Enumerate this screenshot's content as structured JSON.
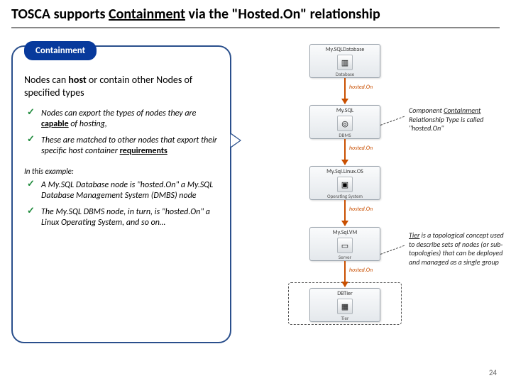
{
  "title_parts": {
    "prefix": "TOSCA supports ",
    "underlined": "Containment",
    "suffix": " via the \"Hosted.On\" relationship"
  },
  "pill_label": "Containment",
  "lead_parts": {
    "p1": "Nodes can ",
    "b1": "host",
    "p2": " or contain other Nodes of specified types"
  },
  "bullets_a": [
    {
      "text": "Nodes can export the types of nodes they are ",
      "term": "capable",
      "tail": " of hosting,"
    },
    {
      "text": "These are matched to other nodes that export their specific host container ",
      "term": "requirements",
      "tail": ""
    }
  ],
  "example_label": "In this example:",
  "bullets_b": [
    {
      "text": "A My.SQL Database node is \"hosted.On\" a My.SQL Database Management System (DMBS) node"
    },
    {
      "text": "The My.SQL DBMS node, in turn, is \"hosted.On\" a Linux Operating System, and so on…"
    }
  ],
  "nodes": {
    "db": {
      "name": "My.SQLDatabase",
      "type": "Database",
      "icon": "▥"
    },
    "dbms": {
      "name": "My.SQL",
      "type": "DBMS",
      "icon": "◎"
    },
    "os": {
      "name": "My.Sql.Linux.OS",
      "type": "Operating System",
      "icon": "▣"
    },
    "vm": {
      "name": "My.Sql.VM",
      "type": "Server",
      "icon": "▭"
    },
    "tier": {
      "name": "DBTier",
      "type": "Tier"
    }
  },
  "rel_label": "hosted.On",
  "notes": {
    "comp": {
      "p1": "Component ",
      "u": "Containment",
      "p2": " Relationship Type is called \"hosted.On\""
    },
    "tier": {
      "u": "Tier",
      "p1": " is a topological concept used to describe sets of nodes (or sub-topologies) that can be deployed and managed as a single group"
    }
  },
  "page_number": "24"
}
